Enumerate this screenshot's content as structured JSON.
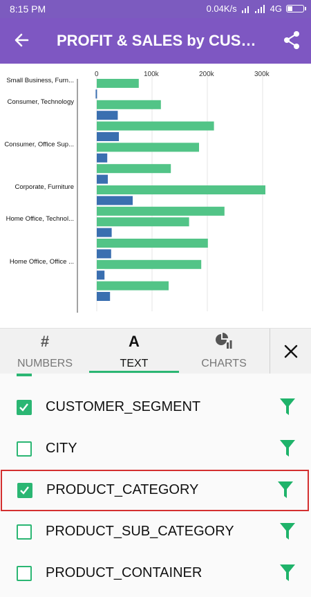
{
  "status": {
    "time": "8:15 PM",
    "speed": "0.04K/s",
    "network": "4G",
    "battery_level": 0.35
  },
  "appbar": {
    "title": "PROFIT & SALES by CUSTOMER_SEGMENT, PRODUCT_CATEGORY"
  },
  "chart_data": {
    "type": "bar",
    "orientation": "horizontal",
    "x_ticks": [
      "0",
      "100k",
      "200k",
      "300k"
    ],
    "xlim": [
      0,
      310000
    ],
    "colors": {
      "green": "#52c487",
      "blue": "#3a6fb0"
    },
    "groups": [
      {
        "label": "Small Business, Furn...",
        "bars": [
          {
            "color": "green",
            "value": 76000
          },
          {
            "color": "blue",
            "value": -2000
          }
        ]
      },
      {
        "label": "Consumer, Technology",
        "bars": [
          {
            "color": "green",
            "value": 116000
          },
          {
            "color": "blue",
            "value": 38000
          },
          {
            "color": "green",
            "value": 212000
          },
          {
            "color": "blue",
            "value": 40000
          }
        ]
      },
      {
        "label": "Consumer, Office Sup...",
        "bars": [
          {
            "color": "green",
            "value": 185000
          },
          {
            "color": "blue",
            "value": 19000
          },
          {
            "color": "green",
            "value": 134000
          },
          {
            "color": "blue",
            "value": 20000
          }
        ]
      },
      {
        "label": "Corporate, Furniture",
        "bars": [
          {
            "color": "green",
            "value": 305000
          },
          {
            "color": "blue",
            "value": 65000
          },
          {
            "color": "green",
            "value": 231000
          }
        ]
      },
      {
        "label": "Home Office, Technol...",
        "bars": [
          {
            "color": "green",
            "value": 167000
          },
          {
            "color": "blue",
            "value": 27000
          },
          {
            "color": "green",
            "value": 201000
          },
          {
            "color": "blue",
            "value": 26000
          }
        ]
      },
      {
        "label": "Home Office, Office ...",
        "bars": [
          {
            "color": "green",
            "value": 189000
          },
          {
            "color": "blue",
            "value": 14000
          },
          {
            "color": "green",
            "value": 130000
          },
          {
            "color": "blue",
            "value": 24000
          }
        ]
      }
    ]
  },
  "tabs": [
    {
      "label": "NUMBERS",
      "icon": "#",
      "active": false
    },
    {
      "label": "TEXT",
      "icon": "A",
      "active": true
    },
    {
      "label": "CHARTS",
      "icon": "chart-icon",
      "active": false
    }
  ],
  "fields": [
    {
      "label": "CUSTOMER_SEGMENT",
      "checked": true,
      "highlight": false
    },
    {
      "label": "CITY",
      "checked": false,
      "highlight": false
    },
    {
      "label": "PRODUCT_CATEGORY",
      "checked": true,
      "highlight": true
    },
    {
      "label": "PRODUCT_SUB_CATEGORY",
      "checked": false,
      "highlight": false
    },
    {
      "label": "PRODUCT_CONTAINER",
      "checked": false,
      "highlight": false
    }
  ],
  "colors": {
    "accent": "#2bb673",
    "appbar": "#7e57c2",
    "highlight": "#d32f2f"
  }
}
